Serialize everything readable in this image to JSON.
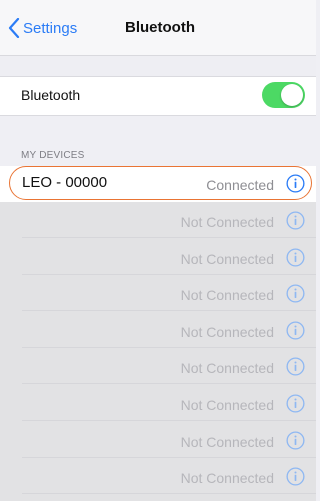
{
  "nav": {
    "back_label": "Settings",
    "title": "Bluetooth"
  },
  "bluetooth": {
    "label": "Bluetooth",
    "enabled": true,
    "toggle_color": "#4cd964"
  },
  "section": {
    "header": "MY DEVICES"
  },
  "devices": [
    {
      "name": "LEO - 00000",
      "status": "Connected"
    },
    {
      "name": "",
      "status": "Not Connected"
    },
    {
      "name": "",
      "status": "Not Connected"
    },
    {
      "name": "",
      "status": "Not Connected"
    },
    {
      "name": "",
      "status": "Not Connected"
    },
    {
      "name": "",
      "status": "Not Connected"
    },
    {
      "name": "",
      "status": "Not Connected"
    },
    {
      "name": "",
      "status": "Not Connected"
    },
    {
      "name": "",
      "status": "Not Connected"
    }
  ],
  "colors": {
    "accent": "#2b7cf6",
    "highlight": "#e97434"
  }
}
